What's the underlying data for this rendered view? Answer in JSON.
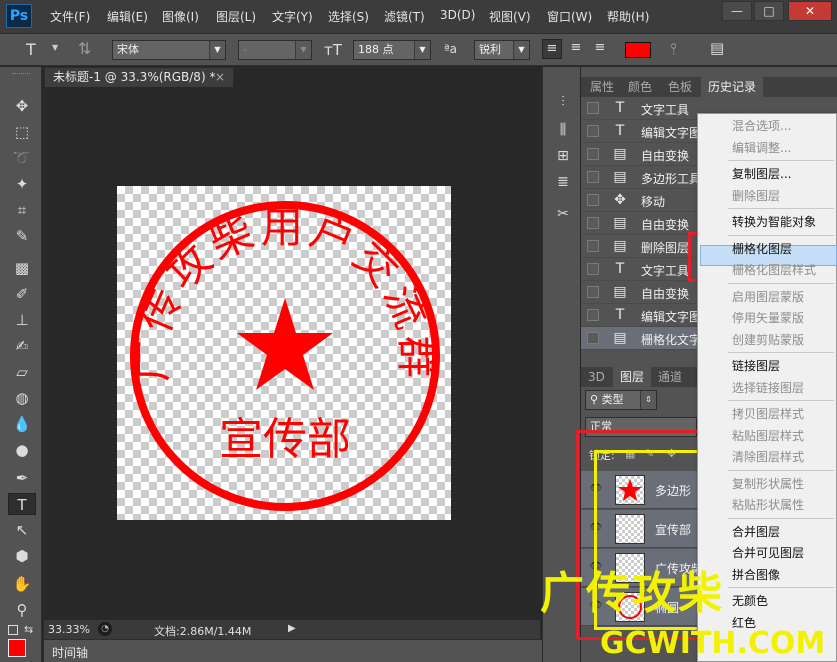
{
  "app": {
    "logo": "Ps",
    "accent_red": "#ff0000"
  },
  "menubar": {
    "items": [
      "文件(F)",
      "编辑(E)",
      "图像(I)",
      "图层(L)",
      "文字(Y)",
      "选择(S)",
      "滤镜(T)",
      "3D(D)",
      "视图(V)",
      "窗口(W)",
      "帮助(H)"
    ],
    "minimize": "—",
    "restore": "□",
    "close": "✕"
  },
  "options": {
    "tool_icon": "T",
    "font_family": "宋体",
    "font_style": "-",
    "font_size": "188 点",
    "aa_label": "ªa",
    "antialias": "锐利",
    "text_color": "#ff0000"
  },
  "document": {
    "tab_title": "未标题-1 @ 33.3%(RGB/8) *",
    "tab_close": "×",
    "zoom": "33.33%",
    "doc_info": "文档:2.86M/1.44M",
    "timeline": "时间轴"
  },
  "seal": {
    "arc_text": "广传攻柴用户交流群",
    "center_text": "宣传部",
    "color": "#ff0000"
  },
  "history_panel": {
    "tabs": [
      "属性",
      "颜色",
      "色板",
      "历史记录"
    ],
    "active_tab": 3,
    "rows": [
      {
        "icon": "T",
        "label": "文字工具"
      },
      {
        "icon": "T",
        "label": "编辑文字图层"
      },
      {
        "icon": "▤",
        "label": "自由变换"
      },
      {
        "icon": "▤",
        "label": "多边形工具"
      },
      {
        "icon": "✥",
        "label": "移动"
      },
      {
        "icon": "▤",
        "label": "自由变换"
      },
      {
        "icon": "▤",
        "label": "删除图层"
      },
      {
        "icon": "T",
        "label": "文字工具"
      },
      {
        "icon": "▤",
        "label": "自由变换"
      },
      {
        "icon": "T",
        "label": "编辑文字图层"
      },
      {
        "icon": "▤",
        "label": "栅格化文字"
      }
    ]
  },
  "layers_panel": {
    "tabs": [
      "3D",
      "图层",
      "通道"
    ],
    "active_tab": 1,
    "filter": "类型",
    "blend_mode": "正常",
    "lock_label": "锁定:",
    "layers": [
      {
        "name": "多边形"
      },
      {
        "name": "宣传部"
      },
      {
        "name": "广传攻柴"
      },
      {
        "name": "椭圆"
      }
    ]
  },
  "context_menu": {
    "items": [
      {
        "label": "混合选项...",
        "enabled": false
      },
      {
        "label": "编辑调整...",
        "enabled": false
      },
      {
        "sep": true
      },
      {
        "label": "复制图层...",
        "enabled": true
      },
      {
        "label": "删除图层",
        "enabled": false
      },
      {
        "sep": true
      },
      {
        "label": "转换为智能对象",
        "enabled": true
      },
      {
        "sep": true
      },
      {
        "label": "栅格化图层",
        "enabled": true,
        "highlighted": true
      },
      {
        "label": "栅格化图层样式",
        "enabled": false
      },
      {
        "sep": true
      },
      {
        "label": "启用图层蒙版",
        "enabled": false
      },
      {
        "label": "停用矢量蒙版",
        "enabled": false
      },
      {
        "label": "创建剪贴蒙版",
        "enabled": false
      },
      {
        "sep": true
      },
      {
        "label": "链接图层",
        "enabled": true
      },
      {
        "label": "选择链接图层",
        "enabled": false
      },
      {
        "sep": true
      },
      {
        "label": "拷贝图层样式",
        "enabled": false
      },
      {
        "label": "粘贴图层样式",
        "enabled": false
      },
      {
        "label": "清除图层样式",
        "enabled": false
      },
      {
        "sep": true
      },
      {
        "label": "复制形状属性",
        "enabled": false
      },
      {
        "label": "粘贴形状属性",
        "enabled": false
      },
      {
        "sep": true
      },
      {
        "label": "合并图层",
        "enabled": true
      },
      {
        "label": "合并可见图层",
        "enabled": true
      },
      {
        "label": "拼合图像",
        "enabled": true
      },
      {
        "sep": true
      },
      {
        "label": "无颜色",
        "enabled": true
      },
      {
        "label": "红色",
        "enabled": true
      }
    ]
  },
  "watermark": {
    "text_top": "广传攻柴",
    "text_bottom": "GCWITH.COM"
  }
}
